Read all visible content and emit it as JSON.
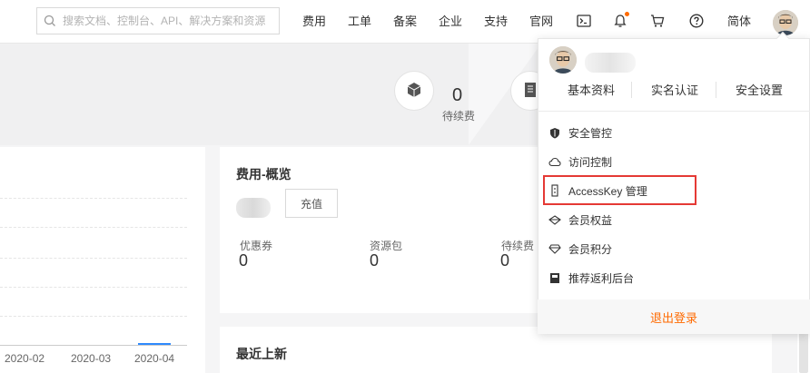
{
  "topbar": {
    "search_placeholder": "搜索文档、控制台、API、解决方案和资源",
    "nav": [
      "费用",
      "工单",
      "备案",
      "企业",
      "支持",
      "官网"
    ],
    "lang": "简体",
    "icons": [
      "terminal-icon",
      "bell-icon",
      "cart-icon",
      "help-icon"
    ],
    "notification_dot_color": "#ff6a00"
  },
  "banner": {
    "stat_value": "0",
    "stat_label": "待续费"
  },
  "chart_card": {
    "ticks": [
      "2020-02",
      "2020-03",
      "2020-04"
    ]
  },
  "fee_card": {
    "title": "费用-概览",
    "recharge_label": "充值",
    "stats": [
      {
        "label": "优惠券",
        "value": "0"
      },
      {
        "label": "资源包",
        "value": "0"
      },
      {
        "label": "待续费",
        "value": "0"
      }
    ]
  },
  "news_card": {
    "title": "最近上新"
  },
  "user_menu": {
    "quick_links": [
      "基本资料",
      "实名认证",
      "安全设置"
    ],
    "items": [
      {
        "label": "安全管控",
        "icon": "shield-icon"
      },
      {
        "label": "访问控制",
        "icon": "cloud-icon"
      },
      {
        "label": "AccessKey 管理",
        "icon": "key-icon",
        "highlighted": true
      },
      {
        "label": "会员权益",
        "icon": "diamond-icon"
      },
      {
        "label": "会员积分",
        "icon": "gem-icon"
      },
      {
        "label": "推荐返利后台",
        "icon": "gift-icon"
      }
    ],
    "logout_label": "退出登录",
    "highlight_color": "#e53935",
    "accent_color": "#ff6a00"
  }
}
